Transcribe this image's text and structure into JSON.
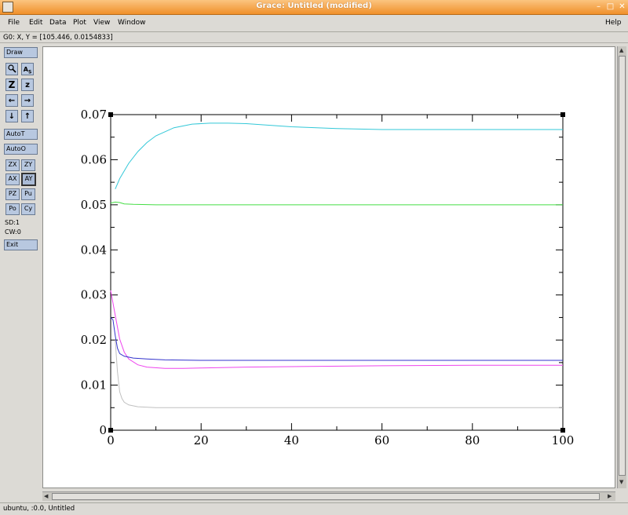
{
  "window": {
    "title": "Grace: Untitled (modified)"
  },
  "menus": [
    "File",
    "Edit",
    "Data",
    "Plot",
    "View",
    "Window"
  ],
  "help": "Help",
  "locator": "G0: X, Y = [105.446, 0.0154833]",
  "toolbar": {
    "draw": "Draw",
    "zoom_icon": "magnifier-icon",
    "autoscale_text_icon": "autoscale-text-icon",
    "zoom_in_label": "Z",
    "zoom_out_label": "z",
    "scroll_left_icon": "arrow-left-icon",
    "scroll_right_icon": "arrow-right-icon",
    "scroll_down_icon": "arrow-down-icon",
    "scroll_up_icon": "arrow-up-icon",
    "autot": "AutoT",
    "autoo": "AutoO",
    "zx": "ZX",
    "zy": "ZY",
    "ax": "AX",
    "ay": "AY",
    "pz": "PZ",
    "pu": "Pu",
    "po": "Po",
    "cy": "Cy",
    "sd": "SD:1",
    "cw": "CW:0",
    "exit": "Exit"
  },
  "status": "ubuntu, :0.0, Untitled",
  "chart_data": {
    "type": "line",
    "title": "",
    "xlabel": "",
    "ylabel": "",
    "xlim": [
      0,
      100
    ],
    "ylim": [
      0,
      0.07
    ],
    "xticks": [
      "0",
      "20",
      "40",
      "60",
      "80",
      "100"
    ],
    "yticks": [
      "0",
      "0.01",
      "0.02",
      "0.03",
      "0.04",
      "0.05",
      "0.06",
      "0.07"
    ],
    "xtick_values": [
      0,
      20,
      40,
      60,
      80,
      100
    ],
    "ytick_values": [
      0,
      0.01,
      0.02,
      0.03,
      0.04,
      0.05,
      0.06,
      0.07
    ],
    "series": [
      {
        "color": "#33c8d8",
        "x": [
          1,
          2,
          4,
          6,
          8,
          10,
          14,
          18,
          22,
          26,
          30,
          40,
          50,
          60,
          80,
          100
        ],
        "y": [
          0.0535,
          0.0558,
          0.0592,
          0.0618,
          0.0638,
          0.0653,
          0.0671,
          0.0679,
          0.0681,
          0.0681,
          0.068,
          0.0673,
          0.0669,
          0.0667,
          0.0667,
          0.0667
        ]
      },
      {
        "color": "#44dd44",
        "x": [
          0,
          1,
          2,
          3,
          5,
          10,
          20,
          40,
          60,
          80,
          100
        ],
        "y": [
          0.0504,
          0.0506,
          0.0505,
          0.0502,
          0.0501,
          0.05,
          0.05,
          0.05,
          0.05,
          0.05,
          0.05
        ]
      },
      {
        "color": "#ee44ee",
        "x": [
          0,
          1,
          2,
          3,
          4,
          6,
          8,
          12,
          16,
          20,
          30,
          40,
          60,
          80,
          100
        ],
        "y": [
          0.031,
          0.0255,
          0.0202,
          0.0173,
          0.0158,
          0.0145,
          0.014,
          0.0137,
          0.0137,
          0.0138,
          0.014,
          0.0141,
          0.0143,
          0.0144,
          0.0144
        ]
      },
      {
        "color": "#3333cc",
        "x": [
          0,
          0.5,
          1,
          1.5,
          2,
          3,
          5,
          8,
          12,
          20,
          40,
          60,
          80,
          100
        ],
        "y": [
          0.025,
          0.0245,
          0.021,
          0.0182,
          0.017,
          0.0164,
          0.016,
          0.0158,
          0.0156,
          0.0155,
          0.0155,
          0.0155,
          0.0155,
          0.0155
        ]
      },
      {
        "color": "#c0c0c0",
        "x": [
          1,
          1.5,
          2,
          2.5,
          3,
          4,
          6,
          10,
          20,
          40,
          60,
          80,
          100
        ],
        "y": [
          0.02,
          0.013,
          0.0085,
          0.007,
          0.0062,
          0.0056,
          0.0052,
          0.005,
          0.005,
          0.005,
          0.005,
          0.005,
          0.005
        ]
      }
    ]
  }
}
